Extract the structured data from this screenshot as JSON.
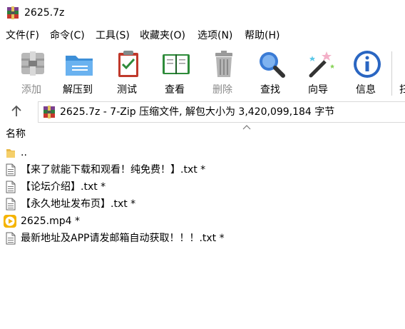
{
  "window": {
    "title": "2625.7z"
  },
  "menu": [
    "文件(F)",
    "命令(C)",
    "工具(S)",
    "收藏夹(O)",
    "选项(N)",
    "帮助(H)"
  ],
  "toolbar": {
    "add": "添加",
    "extract": "解压到",
    "test": "测试",
    "view": "查看",
    "delete": "删除",
    "find": "查找",
    "wizard": "向导",
    "info": "信息",
    "more": "扫"
  },
  "address": {
    "path": "2625.7z - 7-Zip 压缩文件, 解包大小为 3,420,099,184 字节"
  },
  "list": {
    "column_name": "名称",
    "items": [
      {
        "name": "..",
        "icon": "folder-up-icon"
      },
      {
        "name": "【来了就能下载和观看！纯免费！】.txt *",
        "icon": "text-file-icon"
      },
      {
        "name": "【论坛介绍】.txt *",
        "icon": "text-file-icon"
      },
      {
        "name": "【永久地址发布页】.txt *",
        "icon": "text-file-icon"
      },
      {
        "name": "2625.mp4 *",
        "icon": "video-file-icon"
      },
      {
        "name": "最新地址及APP请发邮箱自动获取！！！.txt *",
        "icon": "text-file-icon"
      }
    ]
  }
}
